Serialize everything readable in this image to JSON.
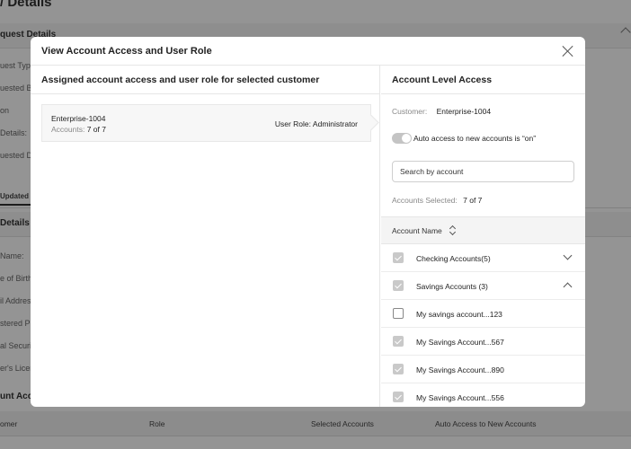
{
  "background": {
    "page_title": "/ Details",
    "section_request": "quest Details",
    "request_labels": [
      "uest Type",
      "uested By",
      "on",
      "Details:",
      "uested Da"
    ],
    "tab_label": "Updated I",
    "section_details": "Details",
    "detail_labels": [
      "Name:",
      "e of Birth:",
      "il Addres",
      "stered Pl",
      "al Securi",
      "er's Licer"
    ],
    "section_accounts": "unt Acc",
    "table_headers": {
      "customer": "omer",
      "role": "Role",
      "selected": "Selected Accounts",
      "auto": "Auto Access to New Accounts"
    }
  },
  "modal": {
    "title": "View Account Access and User Role",
    "left": {
      "heading": "Assigned account access and user role for selected customer",
      "customer_name": "Enterprise-1004",
      "accounts_key": "Accounts:",
      "accounts_value": "7 of 7",
      "role_key": "User Role:",
      "role_value": "Administrator"
    },
    "right": {
      "heading": "Account Level Access",
      "customer_key": "Customer:",
      "customer_value": "Enterprise-1004",
      "toggle_label": "Auto access to new accounts is “on”",
      "search_placeholder": "Search by account",
      "selected_key": "Accounts Selected:",
      "selected_value": "7 of 7",
      "column_header": "Account Name",
      "groups": [
        {
          "label": "Checking Accounts(5)",
          "checked": true,
          "expanded": false
        },
        {
          "label": "Savings Accounts (3)",
          "checked": true,
          "expanded": true
        }
      ],
      "accounts": [
        {
          "label": "My savings account...123",
          "checked": false
        },
        {
          "label": "My Savings Account...567",
          "checked": true
        },
        {
          "label": "My Savings Account...890",
          "checked": true
        },
        {
          "label": "My Savings Account...556",
          "checked": true
        }
      ]
    }
  }
}
